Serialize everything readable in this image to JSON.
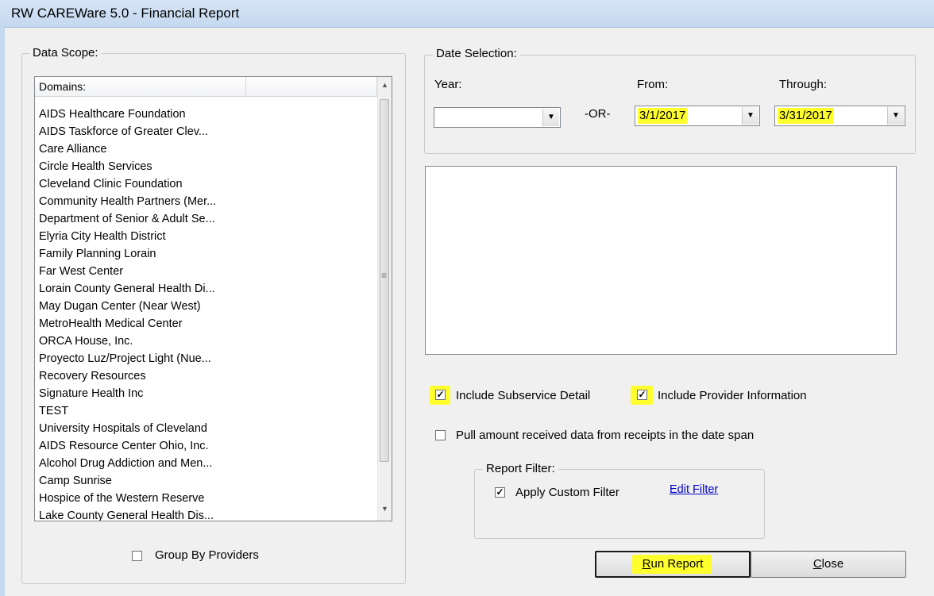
{
  "window": {
    "title": "RW CAREWare 5.0 - Financial Report"
  },
  "data_scope": {
    "legend": "Data Scope:",
    "columns": [
      "Domains:",
      ""
    ],
    "domains": [
      "AIDS Healthcare Foundation",
      "AIDS Taskforce of Greater Clev...",
      "Care Alliance",
      "Circle Health Services",
      "Cleveland Clinic Foundation",
      "Community Health Partners (Mer...",
      "Department of Senior & Adult Se...",
      "Elyria City Health District",
      "Family Planning Lorain",
      "Far West Center",
      "Lorain County General Health Di...",
      "May Dugan Center (Near West)",
      "MetroHealth Medical Center",
      "ORCA House, Inc.",
      "Proyecto Luz/Project Light (Nue...",
      "Recovery Resources",
      "Signature Health Inc",
      "TEST",
      "University Hospitals of Cleveland",
      "AIDS Resource Center Ohio, Inc.",
      "Alcohol Drug Addiction and Men...",
      "Camp Sunrise",
      "Hospice of the Western Reserve",
      "Lake County General Health Dis..."
    ],
    "group_by_providers": {
      "label": "Group By Providers",
      "checked": false
    }
  },
  "date_selection": {
    "legend": "Date Selection:",
    "year_label": "Year:",
    "year_value": "",
    "or_label": "-OR-",
    "from_label": "From:",
    "from_value": "3/1/2017",
    "through_label": "Through:",
    "through_value": "3/31/2017"
  },
  "options": {
    "include_subservice": {
      "label": "Include Subservice Detail",
      "checked": true
    },
    "include_provider": {
      "label": "Include Provider Information",
      "checked": true
    },
    "pull_amount": {
      "label": "Pull amount received data from receipts in the date span",
      "checked": false
    }
  },
  "report_filter": {
    "legend": "Report Filter:",
    "apply_custom": {
      "label": "Apply Custom Filter",
      "checked": true
    },
    "edit_filter_link": "Edit Filter"
  },
  "buttons": {
    "run_report_mnemonic": "R",
    "run_report_rest": "un Report",
    "close_mnemonic": "C",
    "close_rest": "lose"
  },
  "colors": {
    "highlight": "#ffff2e",
    "link": "#0000cc",
    "titlebar": "#c4d8ef"
  },
  "icons": {
    "dropdown": "chevron-down-icon",
    "check": "checkmark-icon"
  }
}
